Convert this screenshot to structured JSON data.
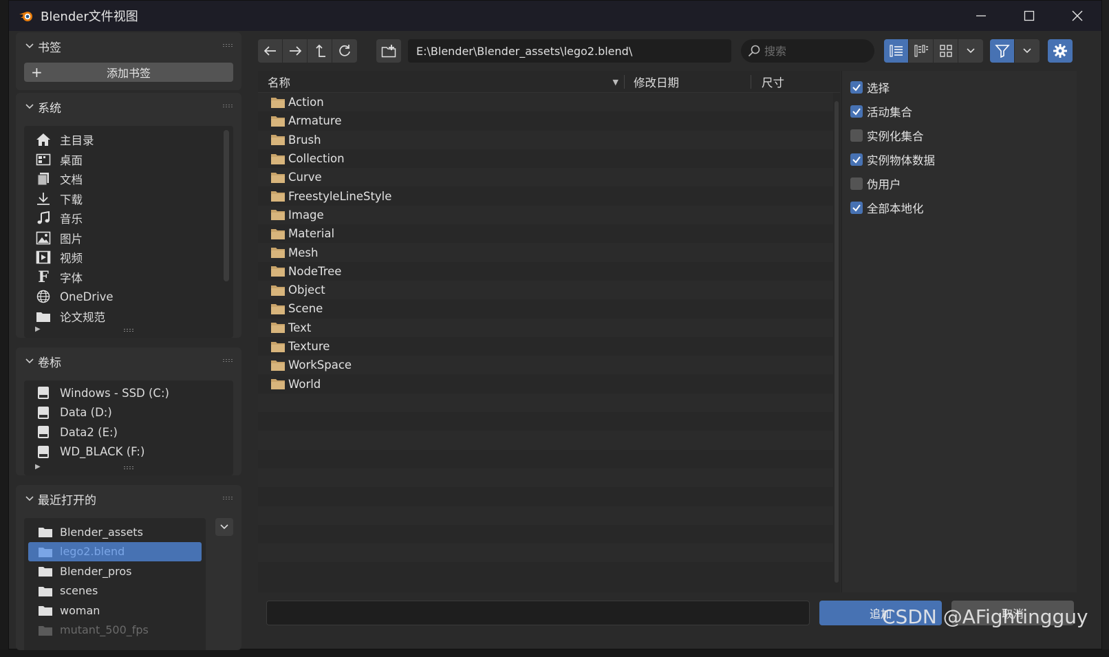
{
  "window": {
    "title": "Blender文件视图",
    "minimize": "—",
    "maximize": "☐",
    "close": "✕"
  },
  "sidebar": {
    "bookmarks": {
      "title": "书签",
      "add_label": "添加书签"
    },
    "system": {
      "title": "系统",
      "items": [
        {
          "label": "主目录",
          "icon": "home-icon"
        },
        {
          "label": "桌面",
          "icon": "desktop-icon"
        },
        {
          "label": "文档",
          "icon": "documents-icon"
        },
        {
          "label": "下载",
          "icon": "download-icon"
        },
        {
          "label": "音乐",
          "icon": "music-icon"
        },
        {
          "label": "图片",
          "icon": "image-icon"
        },
        {
          "label": "视频",
          "icon": "video-icon"
        },
        {
          "label": "字体",
          "icon": "font-icon"
        },
        {
          "label": "OneDrive",
          "icon": "globe-icon"
        },
        {
          "label": "论文规范",
          "icon": "folder-icon"
        }
      ]
    },
    "volumes": {
      "title": "卷标",
      "items": [
        {
          "label": "Windows - SSD (C:)"
        },
        {
          "label": "Data (D:)"
        },
        {
          "label": "Data2 (E:)"
        },
        {
          "label": "WD_BLACK (F:)"
        }
      ]
    },
    "recent": {
      "title": "最近打开的",
      "items": [
        {
          "label": "Blender_assets",
          "selected": false
        },
        {
          "label": "lego2.blend",
          "selected": true
        },
        {
          "label": "Blender_pros",
          "selected": false
        },
        {
          "label": "scenes",
          "selected": false
        },
        {
          "label": "woman",
          "selected": false
        },
        {
          "label": "mutant_500_fps",
          "selected": false
        }
      ]
    }
  },
  "toolbar": {
    "path": "E:\\Blender\\Blender_assets\\lego2.blend\\",
    "search_placeholder": "搜索"
  },
  "filelist": {
    "columns": {
      "name": "名称",
      "date": "修改日期",
      "size": "尺寸"
    },
    "rows": [
      "Action",
      "Armature",
      "Brush",
      "Collection",
      "Curve",
      "FreestyleLineStyle",
      "Image",
      "Material",
      "Mesh",
      "NodeTree",
      "Object",
      "Scene",
      "Text",
      "Texture",
      "WorkSpace",
      "World"
    ]
  },
  "options": {
    "items": [
      {
        "label": "选择",
        "checked": true
      },
      {
        "label": "活动集合",
        "checked": true
      },
      {
        "label": "实例化集合",
        "checked": false
      },
      {
        "label": "实例物体数据",
        "checked": true
      },
      {
        "label": "伪用户",
        "checked": false
      },
      {
        "label": "全部本地化",
        "checked": true
      }
    ]
  },
  "bottom": {
    "filename_value": "",
    "append_label": "追加",
    "cancel_label": "取消"
  },
  "watermark": "CSDN @AFightingguy",
  "colors": {
    "accent": "#4772b3",
    "titlebar": "#1d1d26",
    "panel": "#303030",
    "field": "#1e1e1e",
    "folder": "#c9a46a"
  }
}
